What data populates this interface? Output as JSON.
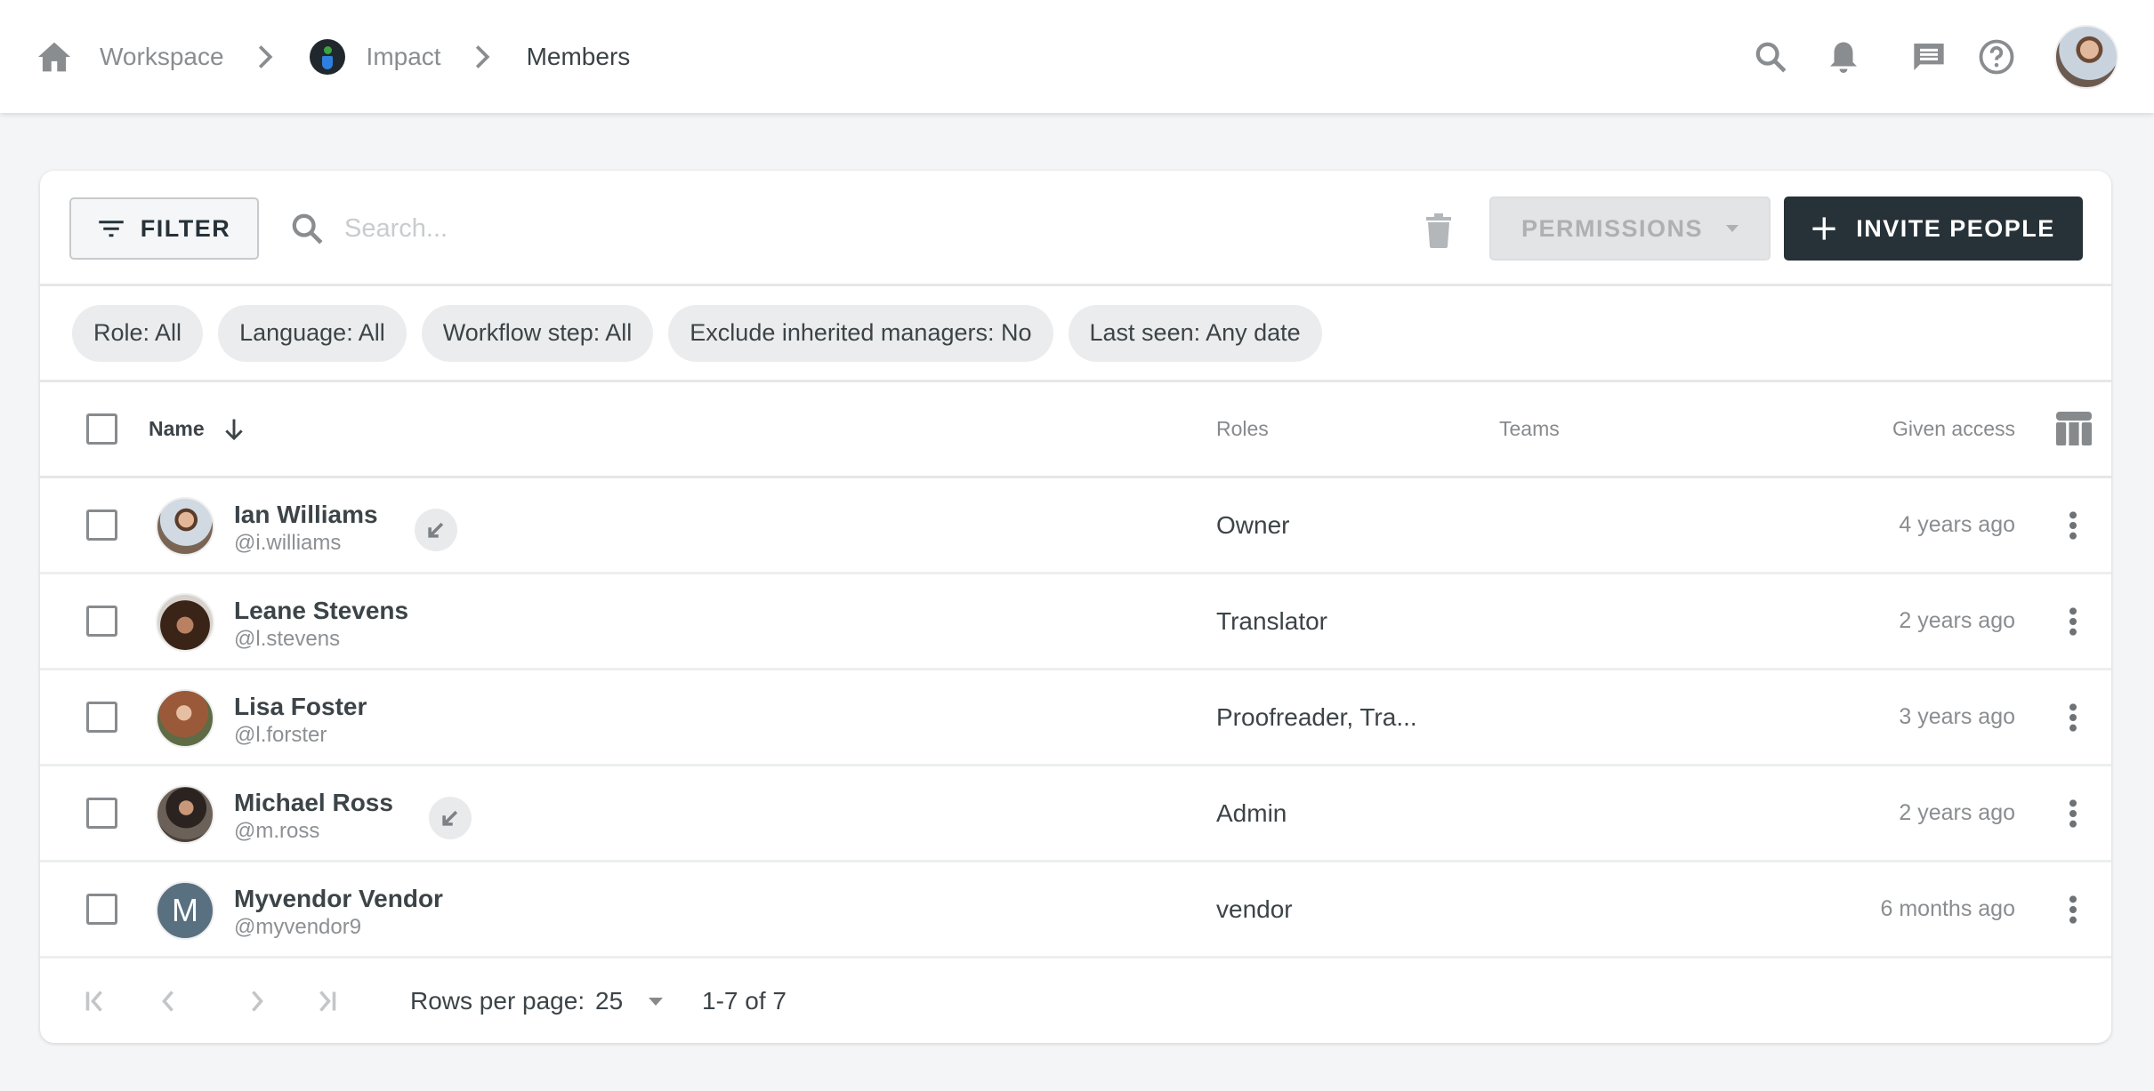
{
  "breadcrumb": {
    "items": [
      {
        "label": "Workspace",
        "icon": "home-icon"
      },
      {
        "label": "Impact",
        "icon": "impact-logo"
      },
      {
        "label": "Members"
      }
    ]
  },
  "topbar": {
    "icons": [
      "search-icon",
      "bell-icon",
      "chat-icon",
      "help-icon"
    ],
    "user_avatar": "current-user-avatar"
  },
  "toolbar": {
    "filter_label": "FILTER",
    "search_placeholder": "Search...",
    "search_value": "",
    "permissions_label": "PERMISSIONS",
    "invite_label": "INVITE PEOPLE"
  },
  "chips": [
    "Role: All",
    "Language: All",
    "Workflow step: All",
    "Exclude inherited managers: No",
    "Last seen: Any date"
  ],
  "table": {
    "columns": {
      "name": "Name",
      "roles": "Roles",
      "teams": "Teams",
      "given_access": "Given access"
    },
    "sort": {
      "column": "name",
      "direction": "descending-arrow"
    },
    "rows": [
      {
        "name": "Ian Williams",
        "handle": "@i.williams",
        "roles": "Owner",
        "teams": "",
        "given_access": "4 years ago",
        "inherited": true,
        "avatar": "photo"
      },
      {
        "name": "Leane Stevens",
        "handle": "@l.stevens",
        "roles": "Translator",
        "teams": "",
        "given_access": "2 years ago",
        "inherited": false,
        "avatar": "photo"
      },
      {
        "name": "Lisa Foster",
        "handle": "@l.forster",
        "roles": "Proofreader, Tra...",
        "teams": "",
        "given_access": "3 years ago",
        "inherited": false,
        "avatar": "photo"
      },
      {
        "name": "Michael Ross",
        "handle": "@m.ross",
        "roles": "Admin",
        "teams": "",
        "given_access": "2 years ago",
        "inherited": true,
        "avatar": "photo"
      },
      {
        "name": "Myvendor Vendor",
        "handle": "@myvendor9",
        "roles": "vendor",
        "teams": "",
        "given_access": "6 months ago",
        "inherited": false,
        "avatar": "M"
      }
    ]
  },
  "pagination": {
    "rows_per_page_label": "Rows per page:",
    "rows_per_page": "25",
    "range": "1-7 of 7"
  },
  "colors": {
    "primary_dark": "#263238",
    "background": "#f4f5f7",
    "chip": "#ebeced",
    "vendor_avatar": "#587080"
  }
}
